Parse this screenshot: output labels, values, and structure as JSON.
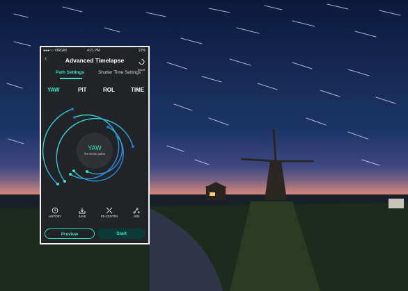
{
  "status_bar": {
    "carrier": "●●●○○ VIRGIN",
    "time": "4:21 PM",
    "battery": "22%"
  },
  "header": {
    "back_icon": "chevron-left-icon",
    "title": "Advanced Timelapse",
    "reset_label": "Reset"
  },
  "tabs": [
    {
      "label": "Path Settings",
      "active": true
    },
    {
      "label": "Shutter Time Settings",
      "active": false
    }
  ],
  "axes": [
    {
      "label": "YAW",
      "active": true
    },
    {
      "label": "PIT"
    },
    {
      "label": "ROL"
    },
    {
      "label": "TIME"
    }
  ],
  "dial": {
    "label": "YAW",
    "sublabel": "the seven paths"
  },
  "toolbar": [
    {
      "label": "HISTORY",
      "icon": "history-icon"
    },
    {
      "label": "SAVE",
      "icon": "save-icon"
    },
    {
      "label": "RE-CENTER",
      "icon": "recenter-icon"
    },
    {
      "label": "ADD",
      "icon": "add-path-icon"
    }
  ],
  "buttons": {
    "preview": "Preview",
    "start": "Start"
  },
  "colors": {
    "accent": "#2fe6c4",
    "accent_blue": "#2a6fe0",
    "panel": "#222327"
  }
}
